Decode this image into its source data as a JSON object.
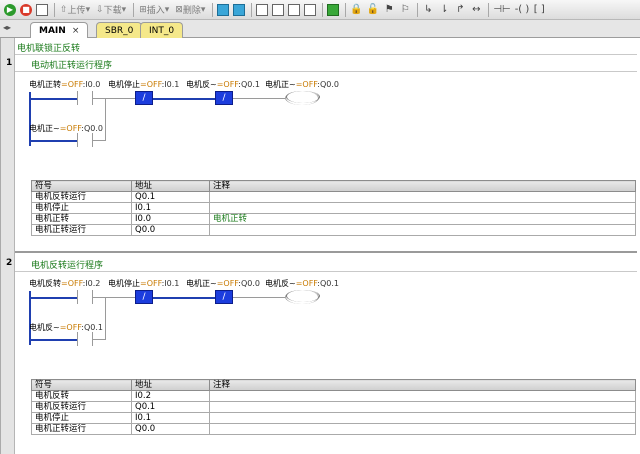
{
  "toolbar": {
    "upload_label": "上传",
    "download_label": "下载",
    "insert_label": "插入",
    "delete_label": "删除"
  },
  "tabs": [
    {
      "label": "MAIN",
      "active": true
    },
    {
      "label": "SBR_0",
      "active": false
    },
    {
      "label": "INT_0",
      "active": false
    }
  ],
  "program_title": "电机联锁正反转",
  "networks": [
    {
      "number": "1",
      "comment": "电动机正转运行程序",
      "rung": {
        "contact1": {
          "symbol": "电机正转",
          "state": "=OFF",
          "addr": ":I0.0"
        },
        "contact2": {
          "symbol": "电机停止",
          "state": "=OFF",
          "addr": ":I0.1"
        },
        "contact3": {
          "symbol": "电机反~",
          "state": "=OFF",
          "addr": ":Q0.1"
        },
        "coil": {
          "symbol": "电机正~",
          "state": "=OFF",
          "addr": ":Q0.0"
        },
        "branch": {
          "symbol": "电机正~",
          "state": "=OFF",
          "addr": ":Q0.0"
        }
      },
      "table": {
        "headers": [
          "符号",
          "地址",
          "注释"
        ],
        "rows": [
          [
            "电机反转运行",
            "Q0.1",
            ""
          ],
          [
            "电机停止",
            "I0.1",
            ""
          ],
          [
            "电机正转",
            "I0.0",
            "电机正转"
          ],
          [
            "电机正转运行",
            "Q0.0",
            ""
          ]
        ]
      }
    },
    {
      "number": "2",
      "comment": "电机反转运行程序",
      "rung": {
        "contact1": {
          "symbol": "电机反转",
          "state": "=OFF",
          "addr": ":I0.2"
        },
        "contact2": {
          "symbol": "电机停止",
          "state": "=OFF",
          "addr": ":I0.1"
        },
        "contact3": {
          "symbol": "电机正~",
          "state": "=OFF",
          "addr": ":Q0.0"
        },
        "coil": {
          "symbol": "电机反~",
          "state": "=OFF",
          "addr": ":Q0.1"
        },
        "branch": {
          "symbol": "电机反~",
          "state": "=OFF",
          "addr": ":Q0.1"
        }
      },
      "table": {
        "headers": [
          "符号",
          "地址",
          "注释"
        ],
        "rows": [
          [
            "电机反转",
            "I0.2",
            ""
          ],
          [
            "电机反转运行",
            "Q0.1",
            ""
          ],
          [
            "电机停止",
            "I0.1",
            ""
          ],
          [
            "电机正转运行",
            "Q0.0",
            ""
          ]
        ]
      }
    }
  ],
  "colors": {
    "rail": "#1f3fb0",
    "nc_contact": "#1c3ddd",
    "state_text": "#c87a00",
    "comment_text": "#1a7a1a"
  }
}
